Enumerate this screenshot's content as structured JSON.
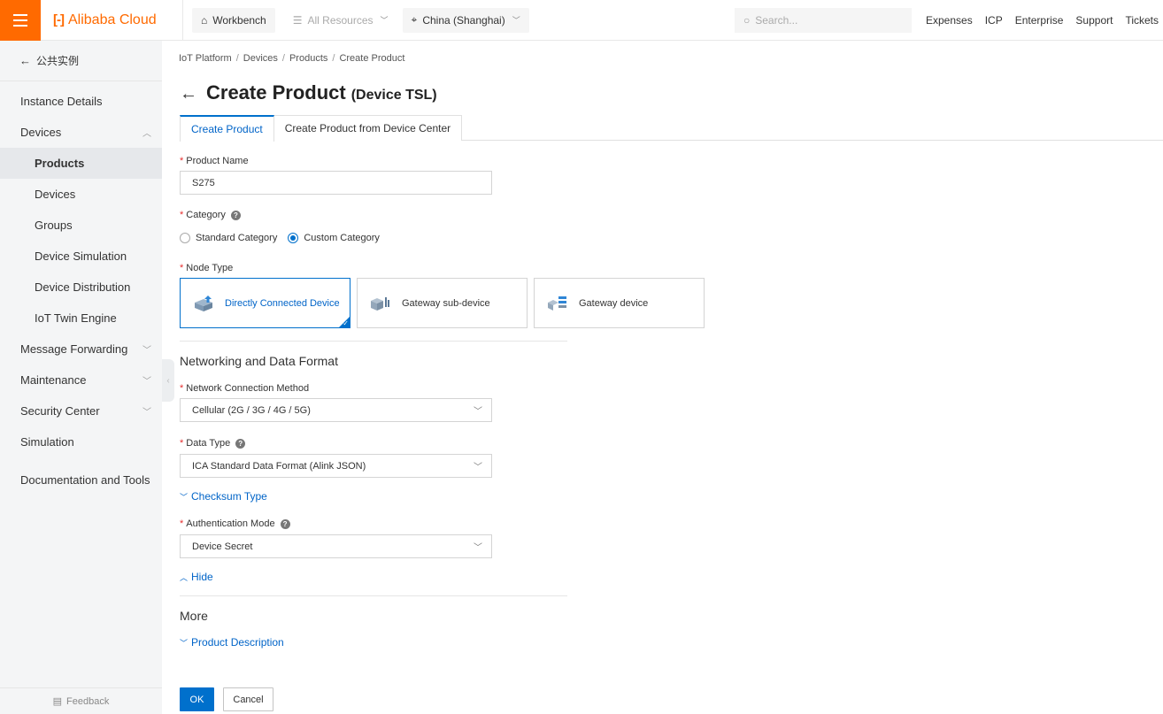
{
  "topbar": {
    "brand": "Alibaba Cloud",
    "brand_mark": "[-]",
    "workbench": "Workbench",
    "all_resources": "All Resources",
    "region": "China (Shanghai)",
    "search_placeholder": "Search...",
    "links": [
      "Expenses",
      "ICP",
      "Enterprise",
      "Support",
      "Tickets"
    ],
    "accent_color": "#ff6a00"
  },
  "sidebar": {
    "back_label": "公共实例",
    "items": [
      {
        "label": "Instance Details",
        "type": "top"
      },
      {
        "label": "Devices",
        "type": "group",
        "expanded": true
      },
      {
        "label": "Products",
        "type": "child",
        "active": true
      },
      {
        "label": "Devices",
        "type": "child"
      },
      {
        "label": "Groups",
        "type": "child"
      },
      {
        "label": "Device Simulation",
        "type": "child"
      },
      {
        "label": "Device Distribution",
        "type": "child"
      },
      {
        "label": "IoT Twin Engine",
        "type": "child"
      },
      {
        "label": "Message Forwarding",
        "type": "group",
        "expanded": false
      },
      {
        "label": "Maintenance",
        "type": "group",
        "expanded": false
      },
      {
        "label": "Security Center",
        "type": "group",
        "expanded": false
      },
      {
        "label": "Simulation",
        "type": "top"
      },
      {
        "label": "Documentation and Tools",
        "type": "top"
      }
    ],
    "feedback": "Feedback"
  },
  "breadcrumb": [
    "IoT Platform",
    "Devices",
    "Products",
    "Create Product"
  ],
  "page": {
    "title": "Create Product",
    "subtitle": "(Device TSL)"
  },
  "tabs": [
    {
      "label": "Create Product",
      "active": true
    },
    {
      "label": "Create Product from Device Center",
      "active": false
    }
  ],
  "form": {
    "product_name_label": "Product Name",
    "product_name_value": "S275",
    "category_label": "Category",
    "category_options": [
      "Standard Category",
      "Custom Category"
    ],
    "category_selected": "Custom Category",
    "node_type_label": "Node Type",
    "node_types": [
      "Directly Connected Device",
      "Gateway sub-device",
      "Gateway device"
    ],
    "node_type_selected": "Directly Connected Device",
    "networking_section_title": "Networking and Data Format",
    "network_label": "Network Connection Method",
    "network_value": "Cellular (2G / 3G / 4G / 5G)",
    "data_type_label": "Data Type",
    "data_type_value": "ICA Standard Data Format (Alink JSON)",
    "checksum_toggle": "Checksum Type",
    "auth_label": "Authentication Mode",
    "auth_value": "Device Secret",
    "hide_toggle": "Hide",
    "more_section_title": "More",
    "product_description_toggle": "Product Description"
  },
  "actions": {
    "ok": "OK",
    "cancel": "Cancel"
  },
  "colors": {
    "primary": "#0070cc",
    "required": "#e62e2e"
  }
}
